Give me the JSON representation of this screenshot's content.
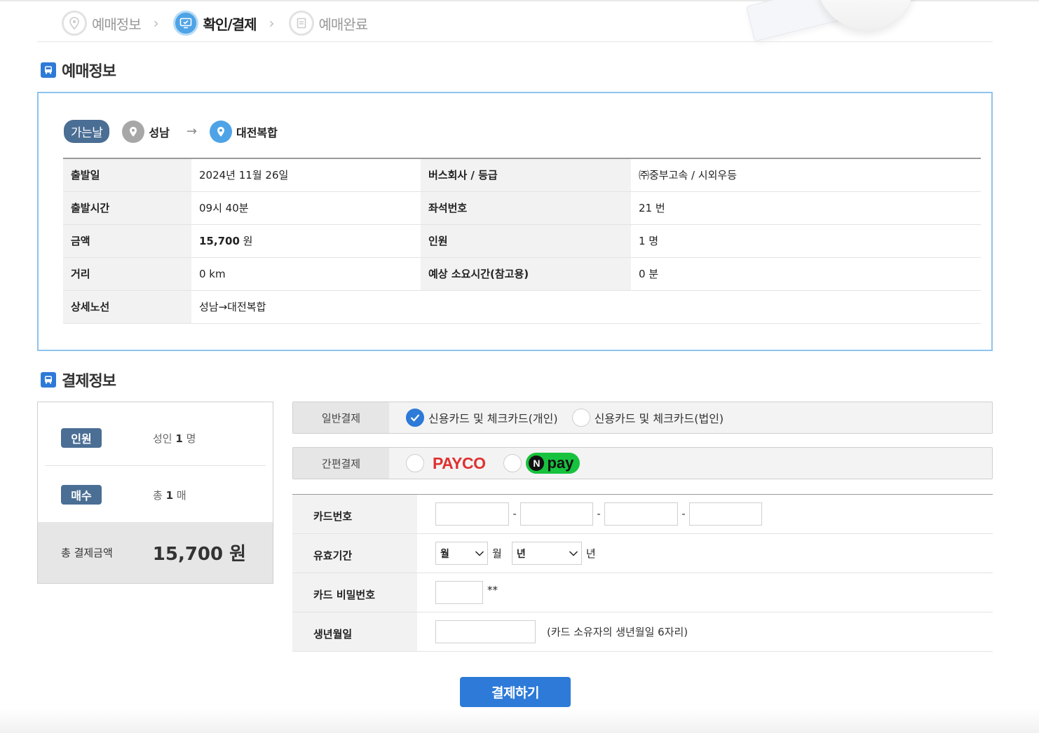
{
  "steps": [
    {
      "label": "예매정보",
      "state": "done"
    },
    {
      "label": "확인/결제",
      "state": "active"
    },
    {
      "label": "예매완료",
      "state": "todo"
    }
  ],
  "booking_section": {
    "title": "예매정보"
  },
  "route": {
    "day_badge": "가는날",
    "origin": "성남",
    "arrow": "→",
    "destination": "대전복합"
  },
  "info": {
    "departure_date_label": "출발일",
    "departure_date": "2024년 11월 26일",
    "company_label": "버스회사 / 등급",
    "company": "㈜중부고속 / 시외우등",
    "departure_time_label": "출발시간",
    "departure_time": "09시 40분",
    "seat_label": "좌석번호",
    "seat": "21 번",
    "fare_label": "금액",
    "fare_amount": "15,700",
    "fare_unit": "원",
    "people_label": "인원",
    "people": "1 명",
    "distance_label": "거리",
    "distance": "0 km",
    "duration_label": "예상 소요시간(참고용)",
    "duration": "0 분",
    "route_detail_label": "상세노선",
    "route_detail": "성남→대전복합"
  },
  "payment_section": {
    "title": "결제정보"
  },
  "summary": {
    "people_badge": "인원",
    "people_prefix": "성인",
    "people_count": "1",
    "people_unit": "명",
    "tickets_badge": "매수",
    "tickets_prefix": "총",
    "tickets_count": "1",
    "tickets_unit": "매",
    "total_label": "총 결제금액",
    "total_amount": "15,700 원"
  },
  "general_payment": {
    "label": "일반결제",
    "options": [
      {
        "label": "신용카드 및 체크카드(개인)",
        "checked": true
      },
      {
        "label": "신용카드 및 체크카드(법인)",
        "checked": false
      }
    ]
  },
  "easy_payment": {
    "label": "간편결제",
    "payco": "PAYCO",
    "npay_n": "N",
    "npay_pay": "pay"
  },
  "card_form": {
    "card_number_label": "카드번호",
    "dash": "-",
    "expiry_label": "유효기간",
    "month_select": "월",
    "month_unit": "월",
    "year_select": "년",
    "year_unit": "년",
    "password_label": "카드 비밀번호",
    "password_suffix": "**",
    "birth_label": "생년월일",
    "birth_hint": "(카드 소유자의 생년월일 6자리)"
  },
  "submit_label": "결제하기",
  "colors": {
    "accent": "#2d7ad8",
    "badge": "#4b6e94",
    "payco": "#e03131",
    "npay": "#17c23e",
    "box_border": "#8dc3ef"
  }
}
